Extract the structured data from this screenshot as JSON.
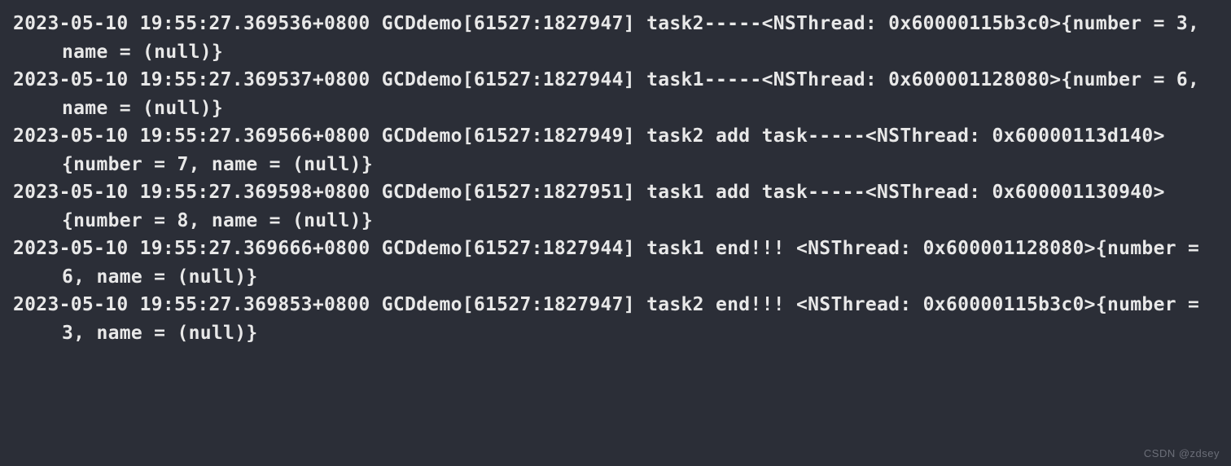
{
  "console": {
    "logs": [
      "2023-05-10 19:55:27.369536+0800 GCDdemo[61527:1827947] task2-----<NSThread: 0x60000115b3c0>{number = 3, name = (null)}",
      "2023-05-10 19:55:27.369537+0800 GCDdemo[61527:1827944] task1-----<NSThread: 0x600001128080>{number = 6, name = (null)}",
      "2023-05-10 19:55:27.369566+0800 GCDdemo[61527:1827949] task2 add task-----<NSThread: 0x60000113d140>{number = 7, name = (null)}",
      "2023-05-10 19:55:27.369598+0800 GCDdemo[61527:1827951] task1 add task-----<NSThread: 0x600001130940>{number = 8, name = (null)}",
      "2023-05-10 19:55:27.369666+0800 GCDdemo[61527:1827944] task1 end!!! <NSThread: 0x600001128080>{number = 6, name = (null)}",
      "2023-05-10 19:55:27.369853+0800 GCDdemo[61527:1827947] task2 end!!! <NSThread: 0x60000115b3c0>{number = 3, name = (null)}"
    ]
  },
  "watermark": "CSDN @zdsey"
}
